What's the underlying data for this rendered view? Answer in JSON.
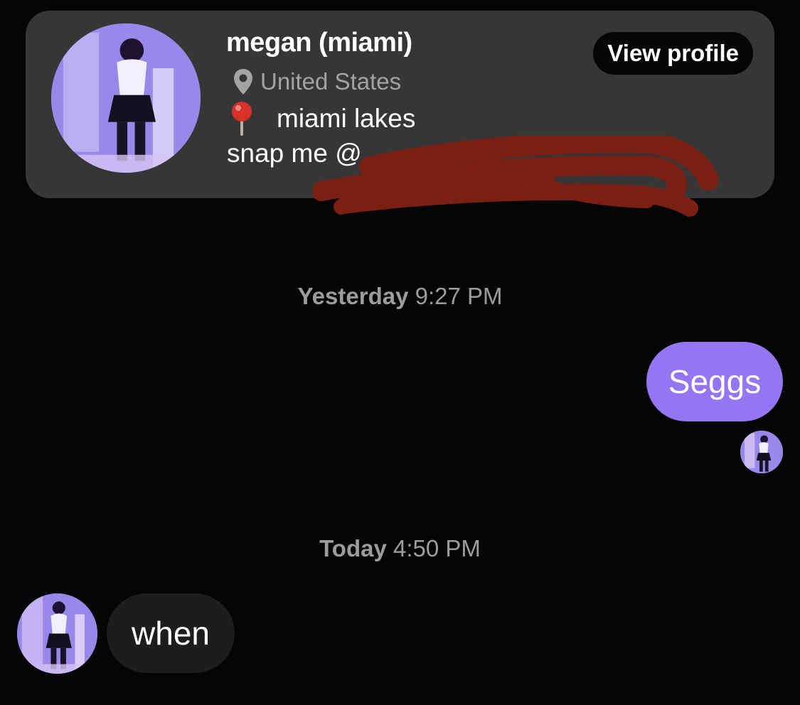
{
  "profile": {
    "name": "megan (miami)",
    "location": "United States",
    "bio_line1": "miami lakes",
    "bio_line2": "snap me @",
    "view_profile_label": "View profile",
    "pin_icon": "location-pin-icon",
    "pushpin_icon": "round-pushpin-icon"
  },
  "timestamps": {
    "yesterday_day": "Yesterday",
    "yesterday_time": "9:27 PM",
    "today_day": "Today",
    "today_time": "4:50 PM"
  },
  "messages": {
    "sent_text": "Seggs",
    "received_text": "when"
  },
  "colors": {
    "background": "#050505",
    "card": "#363636",
    "sent_bubble": "#9576f2",
    "received_bubble": "#1d1d1d",
    "redaction": "#7a1f14"
  }
}
